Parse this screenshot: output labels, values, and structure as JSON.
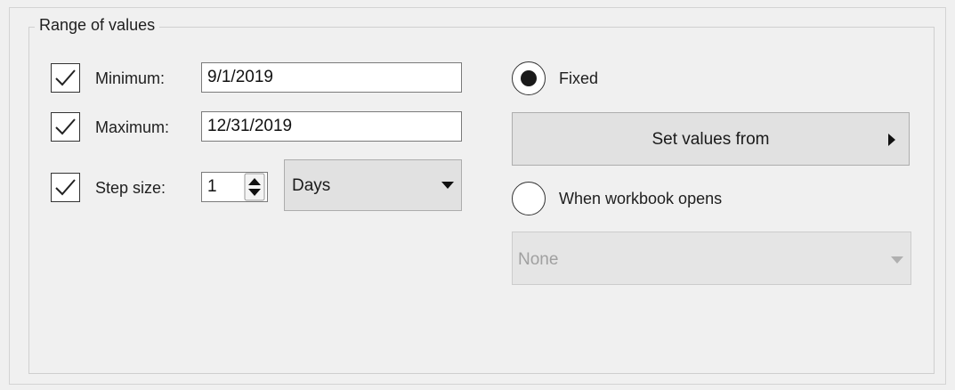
{
  "group": {
    "title": "Range of values"
  },
  "minimum": {
    "checked": true,
    "label": "Minimum:",
    "value": "9/1/2019"
  },
  "maximum": {
    "checked": true,
    "label": "Maximum:",
    "value": "12/31/2019"
  },
  "step": {
    "checked": true,
    "label": "Step size:",
    "value": "1",
    "unit": "Days",
    "unit_icon": "caret-down-icon"
  },
  "fixed": {
    "label": "Fixed",
    "selected": true
  },
  "set_values_button": {
    "label": "Set values from",
    "icon": "caret-right-icon"
  },
  "when_opens": {
    "label": "When workbook opens",
    "selected": false
  },
  "workbook_open_select": {
    "value": "None",
    "enabled": false,
    "icon": "caret-down-icon"
  },
  "colors": {
    "disabled_text": "#a0a0a0",
    "field_border": "#7a7a7a",
    "button_bg": "#e1e1e1"
  }
}
